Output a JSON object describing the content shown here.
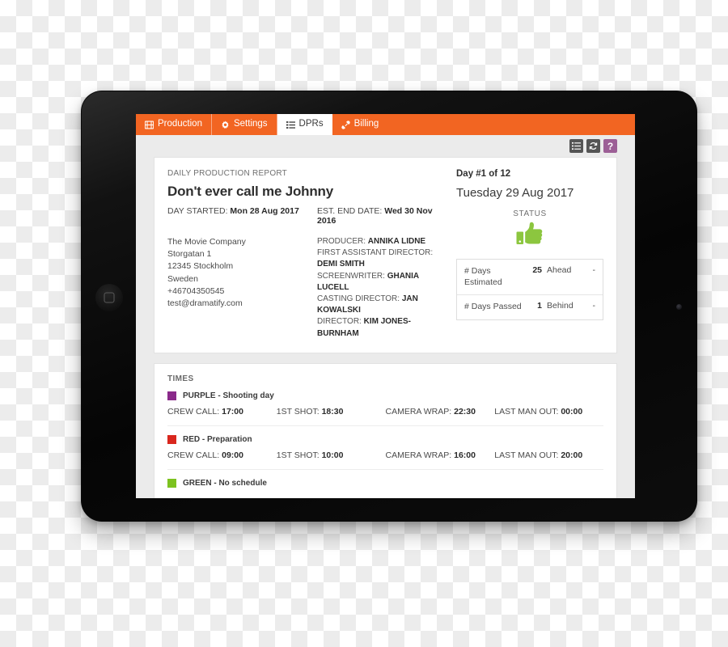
{
  "app": {
    "tabs": [
      {
        "label": "Production",
        "icon": "film-grid-icon",
        "active": false
      },
      {
        "label": "Settings",
        "icon": "gear-icon",
        "active": false
      },
      {
        "label": "DPRs",
        "icon": "list-icon",
        "active": true
      },
      {
        "label": "Billing",
        "icon": "tag-icon",
        "active": false
      }
    ]
  },
  "toolbar": {
    "list_button": "list-view-icon",
    "refresh_button": "refresh-icon",
    "help_button": "?"
  },
  "report": {
    "kicker": "DAILY PRODUCTION REPORT",
    "title": "Don't ever call me Johnny",
    "day_started_label": "DAY STARTED:",
    "day_started_value": "Mon 28 Aug 2017",
    "est_end_label": "EST. END DATE:",
    "est_end_value": "Wed 30 Nov 2016",
    "address": [
      "The Movie Company",
      "Storgatan 1",
      "12345 Stockholm",
      "Sweden",
      "+46704350545",
      "test@dramatify.com"
    ],
    "credits": [
      {
        "role": "PRODUCER:",
        "name": "ANNIKA LIDNE"
      },
      {
        "role": "FIRST ASSISTANT DIRECTOR:",
        "name": "DEMI SMITH"
      },
      {
        "role": "SCREENWRITER:",
        "name": "GHANIA LUCELL"
      },
      {
        "role": "CASTING DIRECTOR:",
        "name": "JAN KOWALSKI"
      },
      {
        "role": "DIRECTOR:",
        "name": "KIM JONES-BURNHAM"
      }
    ]
  },
  "status_panel": {
    "day_count": "Day #1 of 12",
    "day_date": "Tuesday 29 Aug 2017",
    "status_label": "STATUS",
    "status_icon": "thumbs-up-icon",
    "status_color": "#8CC63F",
    "stats": [
      {
        "name": "# Days Estimated",
        "value": "25",
        "label": "Ahead",
        "dash": "-"
      },
      {
        "name": "# Days Passed",
        "value": "1",
        "label": "Behind",
        "dash": "-"
      }
    ]
  },
  "times": {
    "heading": "TIMES",
    "groups": [
      {
        "color": "#8A2A8A",
        "label": "PURPLE - Shooting day",
        "cells": [
          {
            "label": "CREW CALL:",
            "value": "17:00"
          },
          {
            "label": "1ST SHOT:",
            "value": "18:30"
          },
          {
            "label": "CAMERA WRAP:",
            "value": "22:30"
          },
          {
            "label": "LAST MAN OUT:",
            "value": "00:00"
          }
        ]
      },
      {
        "color": "#D9271E",
        "label": "RED - Preparation",
        "cells": [
          {
            "label": "CREW CALL:",
            "value": "09:00"
          },
          {
            "label": "1ST SHOT:",
            "value": "10:00"
          },
          {
            "label": "CAMERA WRAP:",
            "value": "16:00"
          },
          {
            "label": "LAST MAN OUT:",
            "value": "20:00"
          }
        ]
      },
      {
        "color": "#7CC21F",
        "label": "GREEN - No schedule",
        "cells": []
      }
    ]
  },
  "theme": {
    "accent_orange": "#F26522",
    "help_purple": "#9C5F96",
    "toolbar_gray": "#555555"
  }
}
